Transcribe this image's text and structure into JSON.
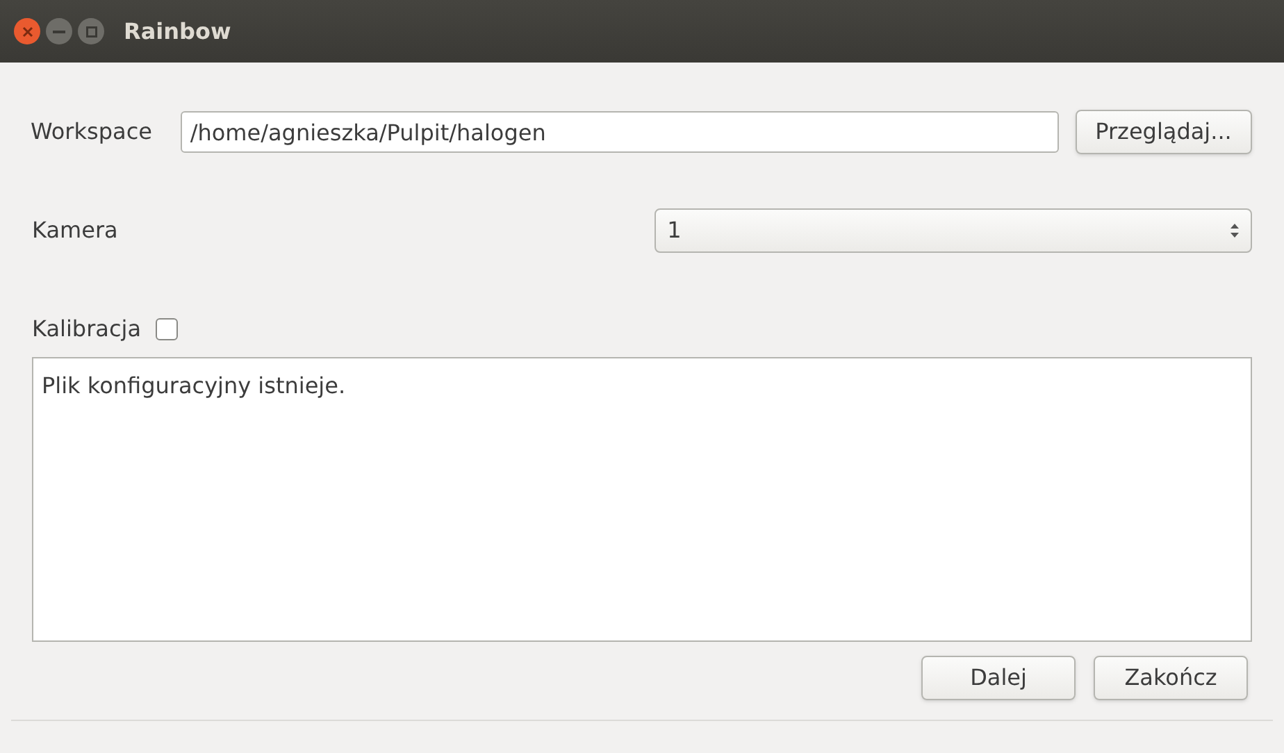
{
  "window": {
    "title": "Rainbow"
  },
  "workspace": {
    "label": "Workspace",
    "value": "/home/agnieszka/Pulpit/halogen",
    "browse_button": "Przeglądaj..."
  },
  "camera": {
    "label": "Kamera",
    "value": "1"
  },
  "calibration": {
    "label": "Kalibracja",
    "checked": false
  },
  "log": {
    "text": "Plik konfiguracyjny istnieje."
  },
  "buttons": [
    "Dalej",
    "Zakończ"
  ]
}
